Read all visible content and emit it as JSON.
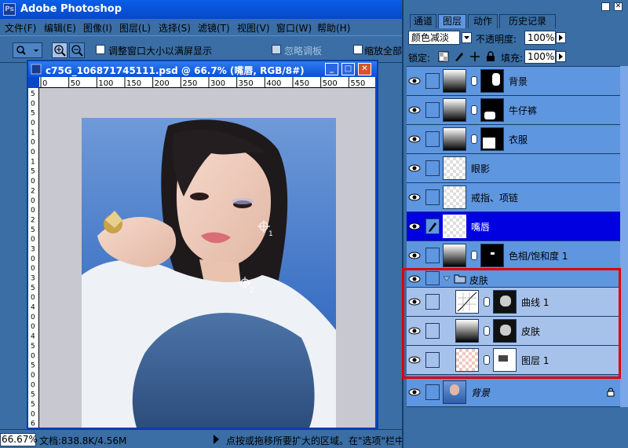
{
  "app": {
    "title": "Adobe Photoshop"
  },
  "menu": [
    "文件(F)",
    "编辑(E)",
    "图像(I)",
    "图层(L)",
    "选择(S)",
    "滤镜(T)",
    "视图(V)",
    "窗口(W)",
    "帮助(H)"
  ],
  "options": {
    "resize_window": "调整窗口大小以满屏显示",
    "ignore_palettes": "忽略调板",
    "zoom_all": "缩放全部"
  },
  "document": {
    "title": "c75G_106871745111.psd @ 66.7% (嘴唇, RGB/8#)",
    "ruler_top": [
      "0",
      "50",
      "100",
      "150",
      "200",
      "250",
      "300",
      "350",
      "400",
      "450",
      "500",
      "550"
    ],
    "ruler_left": [
      "5",
      "0",
      "5",
      "0",
      "1",
      "0",
      "0",
      "1",
      "5",
      "0",
      "2",
      "0",
      "0",
      "2",
      "5",
      "0",
      "3",
      "0",
      "0",
      "3",
      "5",
      "0",
      "4",
      "0",
      "0",
      "4",
      "5",
      "0",
      "5",
      "0",
      "0",
      "5",
      "5",
      "0",
      "6"
    ],
    "markers": [
      "1",
      "2"
    ]
  },
  "status": {
    "zoom": "66.67%",
    "doc": "文档:838.8K/4.56M",
    "hint": "点按或拖移所要扩大的区域。在\"选项\"栏中"
  },
  "panel": {
    "tabs": [
      "通道",
      "图层",
      "动作",
      "历史记录"
    ],
    "blend_mode": "颜色减淡",
    "opacity_label": "不透明度:",
    "opacity_value": "100%",
    "lock_label": "锁定:",
    "fill_label": "填充:",
    "fill_value": "100%"
  },
  "layers": [
    {
      "name": "背景",
      "type": "levels-mask"
    },
    {
      "name": "牛仔裤",
      "type": "levels-mask"
    },
    {
      "name": "衣服",
      "type": "levels-mask"
    },
    {
      "name": "眼影",
      "type": "pixel"
    },
    {
      "name": "戒指、项链",
      "type": "pixel"
    },
    {
      "name": "嘴唇",
      "type": "pixel",
      "selected": true
    },
    {
      "name": "色相/饱和度 1",
      "type": "hue-mask"
    },
    {
      "name": "皮肤",
      "type": "group"
    },
    {
      "name": "曲线 1",
      "type": "curves-mask",
      "sub": true
    },
    {
      "name": "皮肤",
      "type": "levels-mask",
      "sub": true
    },
    {
      "name": "图层 1",
      "type": "pixel-mask",
      "sub": true
    },
    {
      "name": "背景",
      "type": "background"
    }
  ],
  "colors": {
    "accent": "#0648c8",
    "selection": "#0000e0",
    "highlight": "#e00000"
  }
}
